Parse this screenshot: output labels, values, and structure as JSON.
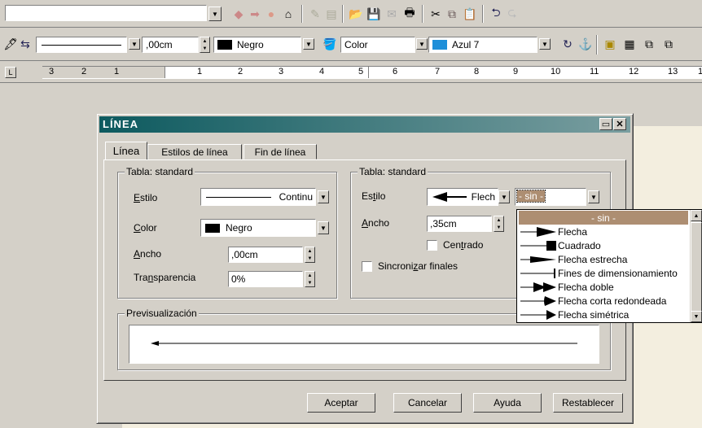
{
  "toolbar1": {
    "url_value": ""
  },
  "toolbar2": {
    "line_width": ",00cm",
    "line_color": "Negro",
    "area_style": "Color",
    "area_color": "Azul 7"
  },
  "ruler": {
    "labels": [
      "3",
      "2",
      "1",
      "1",
      "2",
      "3",
      "4",
      "5",
      "6",
      "7",
      "8",
      "9",
      "10",
      "11",
      "12",
      "13",
      "1"
    ]
  },
  "dialog": {
    "title": "LÍNEA",
    "tabs": [
      "Línea",
      "Estilos de línea",
      "Fin de línea"
    ],
    "line_group": {
      "title": "Tabla: standard",
      "estilo_label": "Estilo",
      "estilo_value": "Continu",
      "color_label": "Color",
      "color_value": "Negro",
      "ancho_label": "Ancho",
      "ancho_value": ",00cm",
      "transparencia_label": "Transparencia",
      "transparencia_value": "0%"
    },
    "arrow_group": {
      "title": "Tabla: standard",
      "estilo_label": "Estilo",
      "start_style": "Flech",
      "end_style": "- sin -",
      "ancho_label": "Ancho",
      "ancho_value": ",35cm",
      "centrado_label": "Centrado",
      "sync_label": "Sincronizar finales"
    },
    "preview_title": "Previsualización",
    "buttons": {
      "ok": "Aceptar",
      "cancel": "Cancelar",
      "help": "Ayuda",
      "reset": "Restablecer"
    },
    "dropdown_options": [
      "- sin -",
      "Flecha",
      "Cuadrado",
      "Flecha estrecha",
      "Fines de dimensionamiento",
      "Flecha doble",
      "Flecha corta redondeada",
      "Flecha simétrica"
    ]
  },
  "colors": {
    "titlebar_start": "#0d5a5f",
    "titlebar_end": "#7a9ea0",
    "area_color_swatch": "#1e8fd9",
    "selected_option": "#ad8e72"
  }
}
